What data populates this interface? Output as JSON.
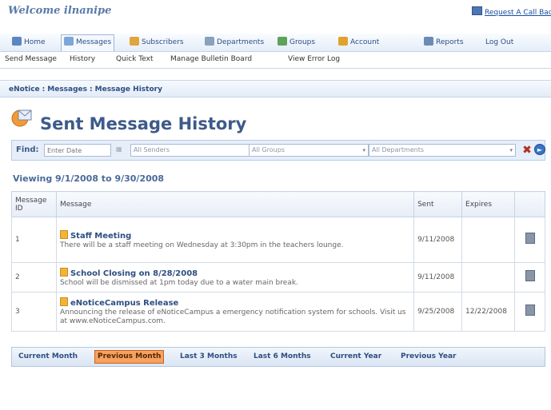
{
  "header": {
    "welcome": "Welcome ilnanipe",
    "callback_link": "Request A Call Back"
  },
  "nav": {
    "items": [
      {
        "label": "Home",
        "icon": "home-icon",
        "color": "#5b86c2"
      },
      {
        "label": "Messages",
        "icon": "messages-icon",
        "color": "#7ea6d8",
        "active": true
      },
      {
        "label": "Subscribers",
        "icon": "subscribers-icon",
        "color": "#e0a53c"
      },
      {
        "label": "Departments",
        "icon": "departments-icon",
        "color": "#8aa0bd"
      },
      {
        "label": "Groups",
        "icon": "groups-icon",
        "color": "#5fa25a"
      },
      {
        "label": "Account",
        "icon": "account-icon",
        "color": "#e1a22d"
      },
      {
        "label": "Reports",
        "icon": "reports-icon",
        "color": "#6c8bb3"
      },
      {
        "label": "Log Out",
        "icon": "",
        "color": ""
      }
    ]
  },
  "subnav": {
    "items": [
      "Send Message",
      "History",
      "Quick Text",
      "Manage Bulletin Board",
      "View Error Log"
    ]
  },
  "breadcrumb": {
    "root": "eNotice",
    "section": "Messages",
    "current": "Message History"
  },
  "page": {
    "title": "Sent Message History"
  },
  "find": {
    "label": "Find:",
    "date_placeholder": "Enter Date",
    "senders": "All Senders",
    "groups": "All Groups",
    "departments": "All Departments"
  },
  "viewing": "Viewing 9/1/2008 to 9/30/2008",
  "table": {
    "headers": {
      "id": "Message ID",
      "message": "Message",
      "sent": "Sent",
      "expires": "Expires"
    },
    "rows": [
      {
        "id": "1",
        "title": "Staff Meeting",
        "body": "There will be a staff meeting on Wednesday at 3:30pm in the teachers lounge.",
        "sent": "9/11/2008",
        "expires": ""
      },
      {
        "id": "2",
        "title": "School Closing on 8/28/2008",
        "body": "School will be dismissed at 1pm today due to a water main break.",
        "sent": "9/11/2008",
        "expires": ""
      },
      {
        "id": "3",
        "title": "eNoticeCampus Release",
        "body": "Announcing the release of eNoticeCampus a emergency notification system for schools. Visit us at www.eNoticeCampus.com.",
        "sent": "9/25/2008",
        "expires": "12/22/2008"
      }
    ]
  },
  "periods": {
    "items": [
      "Current Month",
      "Previous Month",
      "Last 3 Months",
      "Last 6 Months",
      "Current Year",
      "Previous Year"
    ],
    "active": "Previous Month"
  }
}
